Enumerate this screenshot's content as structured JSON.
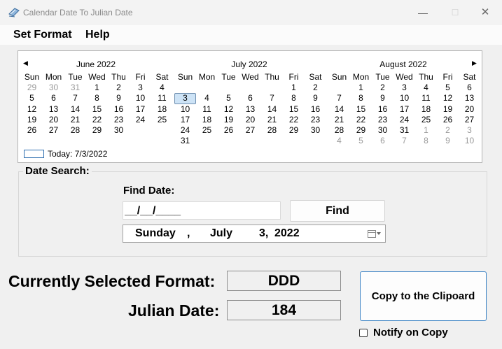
{
  "window": {
    "title": "Calendar Date To Julian Date",
    "minimize_glyph": "—",
    "maximize_glyph": "☐",
    "close_glyph": "✕"
  },
  "menu": {
    "items": [
      {
        "label": "Set Format"
      },
      {
        "label": "Help"
      }
    ]
  },
  "calendar": {
    "prev_glyph": "◀",
    "next_glyph": "▶",
    "selected_day": "3",
    "selected_month_index": 1,
    "day_headers": [
      "Sun",
      "Mon",
      "Tue",
      "Wed",
      "Thu",
      "Fri",
      "Sat"
    ],
    "months": [
      {
        "title": "June 2022",
        "days": [
          "29",
          "30",
          "31",
          "1",
          "2",
          "3",
          "4",
          "5",
          "6",
          "7",
          "8",
          "9",
          "10",
          "11",
          "12",
          "13",
          "14",
          "15",
          "16",
          "17",
          "18",
          "19",
          "20",
          "21",
          "22",
          "23",
          "24",
          "25",
          "26",
          "27",
          "28",
          "29",
          "30",
          "",
          "",
          "",
          "",
          "",
          "",
          "",
          "",
          ""
        ],
        "other": [
          0,
          1,
          2
        ]
      },
      {
        "title": "July 2022",
        "days": [
          "",
          "",
          "",
          "",
          "",
          "1",
          "2",
          "3",
          "4",
          "5",
          "6",
          "7",
          "8",
          "9",
          "10",
          "11",
          "12",
          "13",
          "14",
          "15",
          "16",
          "17",
          "18",
          "19",
          "20",
          "21",
          "22",
          "23",
          "24",
          "25",
          "26",
          "27",
          "28",
          "29",
          "30",
          "31",
          "",
          "",
          "",
          "",
          "",
          ""
        ],
        "other": []
      },
      {
        "title": "August 2022",
        "days": [
          "",
          "1",
          "2",
          "3",
          "4",
          "5",
          "6",
          "7",
          "8",
          "9",
          "10",
          "11",
          "12",
          "13",
          "14",
          "15",
          "16",
          "17",
          "18",
          "19",
          "20",
          "21",
          "22",
          "23",
          "24",
          "25",
          "26",
          "27",
          "28",
          "29",
          "30",
          "31",
          "1",
          "2",
          "3",
          "4",
          "5",
          "6",
          "7",
          "8",
          "9",
          "10"
        ],
        "other": [
          32,
          33,
          34,
          35,
          36,
          37,
          38,
          39,
          40,
          41
        ]
      }
    ],
    "today_label": "Today: 7/3/2022"
  },
  "search": {
    "group_title": "Date Search:",
    "find_label": "Find Date:",
    "date_input_value": "__/__/____",
    "find_button_label": "Find",
    "picker": {
      "day_of_week": "Sunday",
      "separator": ",",
      "month": "July",
      "day": "3,",
      "year": "2022"
    }
  },
  "results": {
    "format_label": "Currently Selected Format:",
    "format_value": "DDD",
    "julian_label": "Julian Date:",
    "julian_value": "184"
  },
  "copy": {
    "button_label": "Copy to the Clipoard",
    "notify_label": "Notify on Copy",
    "notify_checked": false
  }
}
